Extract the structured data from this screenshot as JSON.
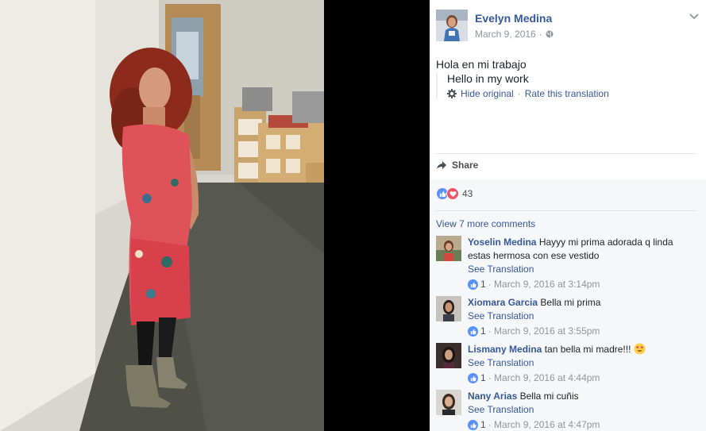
{
  "post": {
    "author": "Evelyn Medina",
    "date": "March 9, 2016",
    "separator": "·",
    "text": "Hola en mi trabajo",
    "translation": "Hello in my work",
    "hide_original": "Hide original",
    "rate_translation": "Rate this translation",
    "link_separator": "·"
  },
  "actions": {
    "share_label": "Share"
  },
  "reactions": {
    "count": "43"
  },
  "comments": {
    "view_more": "View 7 more comments",
    "items": [
      {
        "name": "Yoselin Medina",
        "text": "Hayyy mi prima adorada q linda estas hermosa con ese vestido",
        "see_translation": "See Translation",
        "likes": "1",
        "meta": "· March 9, 2016 at 3:14pm"
      },
      {
        "name": "Xiomara Garcia",
        "text": "Bella mi prima",
        "see_translation": "See Translation",
        "likes": "1",
        "meta": "· March 9, 2016 at 3:55pm"
      },
      {
        "name": "Lismany Medina",
        "text": "tan bella mi madre!!!",
        "see_translation": "See Translation",
        "likes": "1",
        "meta": "· March 9, 2016 at 4:44pm"
      },
      {
        "name": "Nany Arias",
        "text": "Bella mi cuñis",
        "see_translation": "See Translation",
        "likes": "1",
        "meta": "· March 9, 2016 at 4:47pm"
      }
    ]
  },
  "colors": {
    "link": "#365899",
    "like_blue": "#5890ff",
    "love_red": "#f25268",
    "panel_gray": "#f6f7f9"
  }
}
